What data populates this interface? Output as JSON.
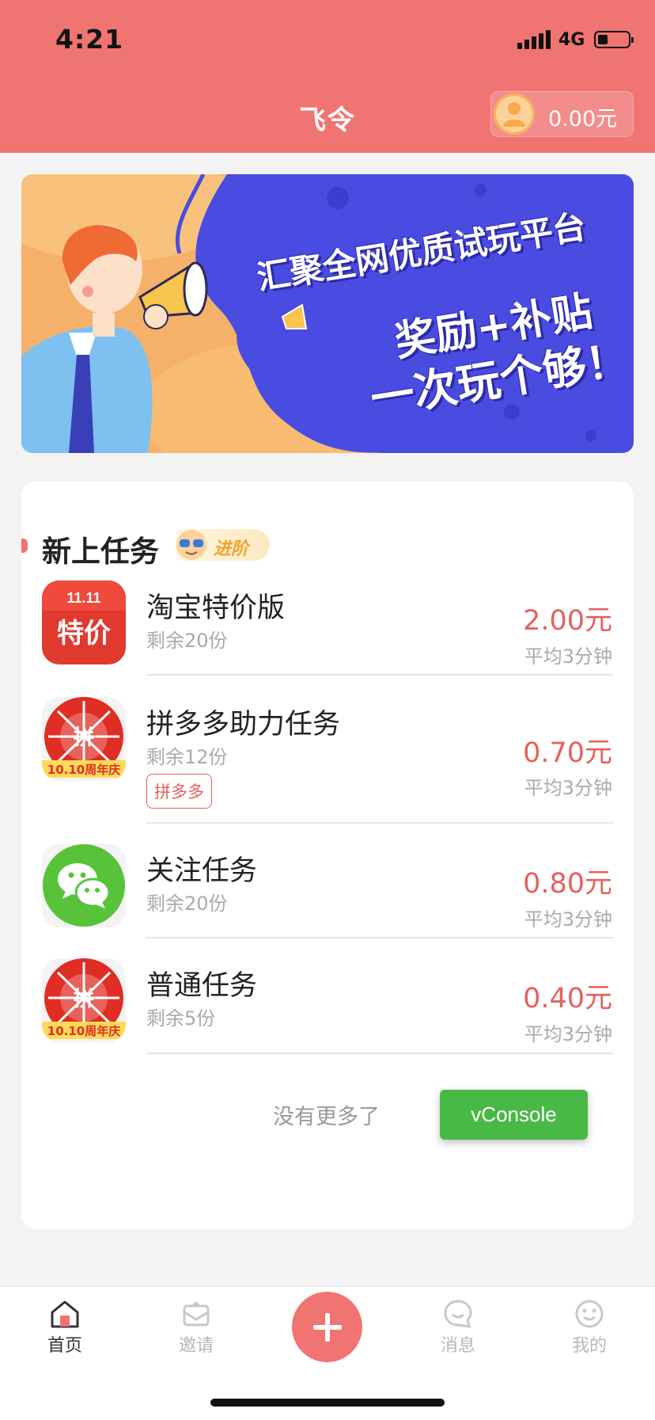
{
  "status_bar": {
    "time": "4:21",
    "network": "4G"
  },
  "header": {
    "title": "飞令",
    "balance": "0.00元"
  },
  "banner": {
    "line1": "汇聚全网优质试玩平台",
    "line2": "奖励+补贴",
    "line3": "一次玩个够！"
  },
  "section": {
    "title": "新上任务",
    "badge": "进阶"
  },
  "tasks": [
    {
      "name": "淘宝特价版",
      "remain": "剩余20份",
      "price": "2.00元",
      "time": "平均3分钟",
      "icon": "taobao-tejia-icon"
    },
    {
      "name": "拼多多助力任务",
      "remain": "剩余12份",
      "tag": "拼多多",
      "price": "0.70元",
      "time": "平均3分钟",
      "icon": "pinduoduo-icon"
    },
    {
      "name": "关注任务",
      "remain": "剩余20份",
      "price": "0.80元",
      "time": "平均3分钟",
      "icon": "wechat-icon"
    },
    {
      "name": "普通任务",
      "remain": "剩余5份",
      "price": "0.40元",
      "time": "平均3分钟",
      "icon": "pinduoduo-icon"
    }
  ],
  "icon_texts": {
    "tejia_top": "11.11",
    "tejia_main": "特价",
    "pdd_main": "拼",
    "pdd_banner": "10.10周年庆"
  },
  "footer": {
    "no_more": "没有更多了",
    "vconsole": "vConsole"
  },
  "tabbar": {
    "home": "首页",
    "invite": "邀请",
    "messages": "消息",
    "mine": "我的"
  },
  "colors": {
    "primary": "#f07472",
    "price": "#e5615e",
    "vconsole": "#48b945",
    "banner_blue": "#4a4be0"
  }
}
